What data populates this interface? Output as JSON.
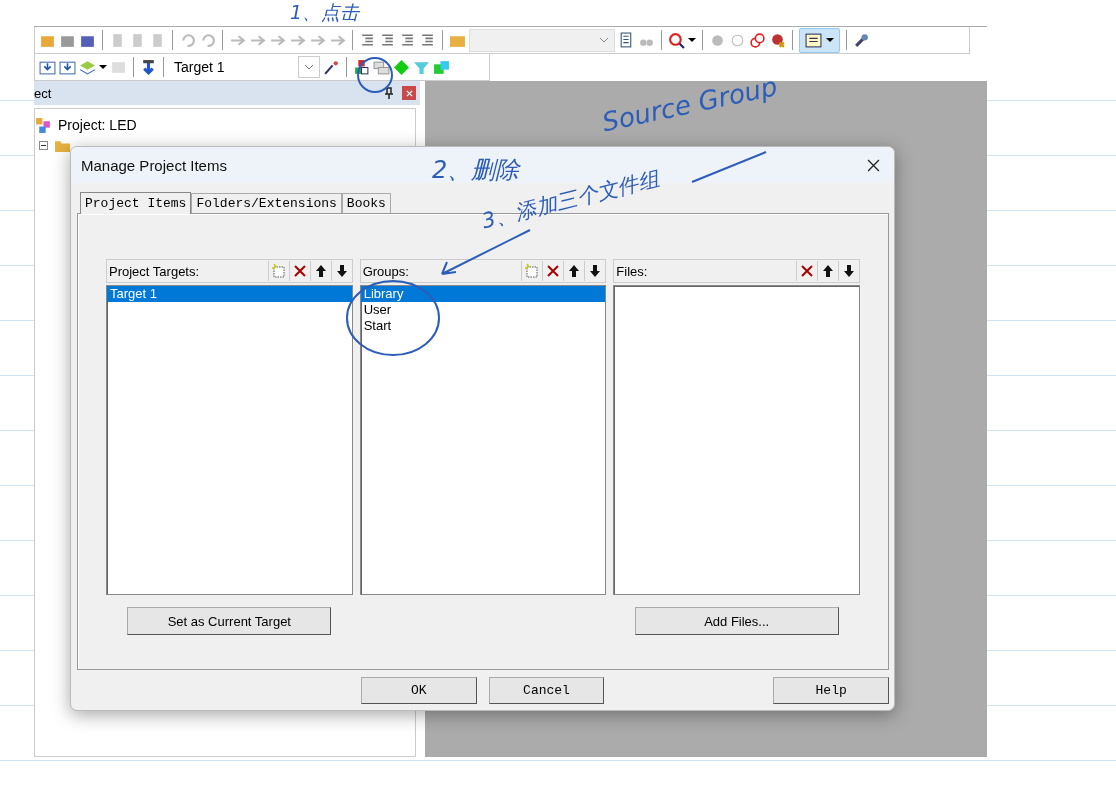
{
  "toolbar_2": {
    "target": "Target 1"
  },
  "project_panel": {
    "title": "ect",
    "tree": [
      {
        "label": "Project: LED",
        "children": [
          {
            "expanded": true
          }
        ]
      }
    ]
  },
  "dialog": {
    "title": "Manage Project Items",
    "tabs": [
      {
        "label": "Project Items",
        "selected": true
      },
      {
        "label": "Folders/Extensions",
        "selected": false
      },
      {
        "label": "Books",
        "selected": false
      }
    ],
    "lists": [
      {
        "title": "Project Targets:",
        "tools": [
          {
            "kind": "new"
          },
          {
            "kind": "delete"
          },
          {
            "kind": "up"
          },
          {
            "kind": "down"
          }
        ],
        "items": [
          {
            "label": "Target 1",
            "selected": true
          }
        ],
        "button": "Set as Current Target"
      },
      {
        "title": "Groups:",
        "tools": [
          {
            "kind": "new"
          },
          {
            "kind": "delete"
          },
          {
            "kind": "up"
          },
          {
            "kind": "down"
          }
        ],
        "items": [
          {
            "label": "Library",
            "selected": true
          },
          {
            "label": "User",
            "selected": false
          },
          {
            "label": "Start",
            "selected": false
          }
        ]
      },
      {
        "title": "Files:",
        "tools": [
          {
            "kind": "delete"
          },
          {
            "kind": "up"
          },
          {
            "kind": "down"
          }
        ],
        "button": "Add Files..."
      }
    ],
    "buttons": [
      "OK",
      "Cancel",
      "Help"
    ]
  },
  "annotations": [
    {
      "text": "1、点击"
    },
    {
      "text": "Source Group"
    },
    {
      "text": "2、删除"
    },
    {
      "text": "3、添加三个文件组"
    }
  ]
}
